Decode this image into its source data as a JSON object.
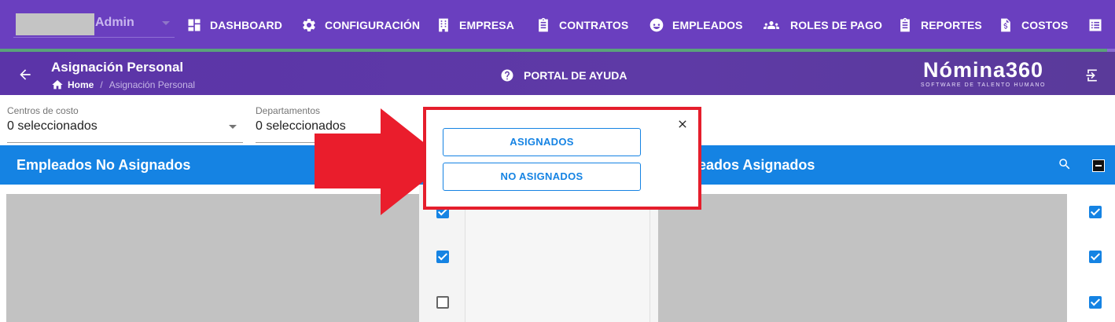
{
  "nav": {
    "user_name": "Admin",
    "items": [
      {
        "label": "DASHBOARD",
        "icon": "dashboard-icon"
      },
      {
        "label": "CONFIGURACIÓN",
        "icon": "gear-icon"
      },
      {
        "label": "EMPRESA",
        "icon": "building-icon"
      },
      {
        "label": "CONTRATOS",
        "icon": "clipboard-icon"
      },
      {
        "label": "EMPLEADOS",
        "icon": "face-icon"
      },
      {
        "label": "ROLES DE PAGO",
        "icon": "people-icon"
      },
      {
        "label": "REPORTES",
        "icon": "assignment-icon"
      },
      {
        "label": "COSTOS",
        "icon": "invoice-icon"
      },
      {
        "label": "",
        "icon": "list-icon"
      }
    ]
  },
  "subheader": {
    "title": "Asignación Personal",
    "breadcrumb_home": "Home",
    "breadcrumb_sep": "/",
    "breadcrumb_current": "Asignación Personal",
    "help_label": "PORTAL DE AYUDA",
    "brand_name": "Nómina360",
    "brand_tagline": "SOFTWARE DE TALENTO HUMANO"
  },
  "filters": {
    "cost_centers_label": "Centros de costo",
    "cost_centers_value": "0 seleccionados",
    "departments_label": "Departamentos",
    "departments_value": "0 seleccionados"
  },
  "panels": {
    "unassigned_title": "Empleados No Asignados",
    "assigned_title_visible": "eados Asignados"
  },
  "checkboxes": {
    "middle": [
      true,
      true,
      false
    ],
    "right": [
      true,
      true,
      true
    ]
  },
  "popup": {
    "assigned_button": "ASIGNADOS",
    "unassigned_button": "NO ASIGNADOS"
  },
  "colors": {
    "nav_bg": "#6a3fbf",
    "accent_blue": "#1583e3",
    "highlight_red": "#e51e2c"
  }
}
